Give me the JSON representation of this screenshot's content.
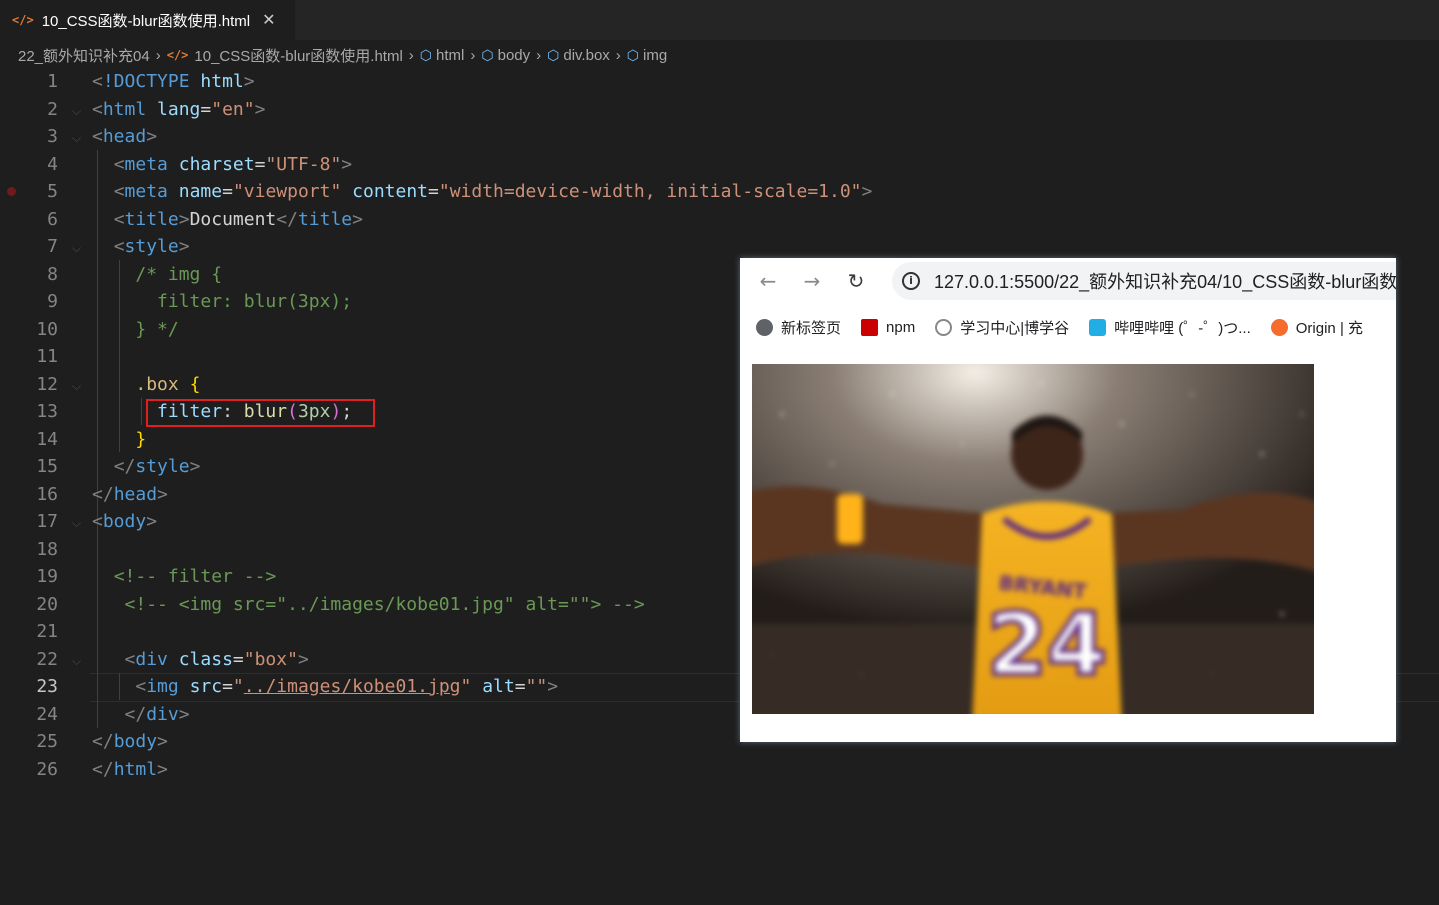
{
  "tab": {
    "icon": "</>",
    "title": "10_CSS函数-blur函数使用.html",
    "close": "✕"
  },
  "breadcrumb": [
    "22_额外知识补充04",
    "10_CSS函数-blur函数使用.html",
    "html",
    "body",
    "div.box",
    "img"
  ],
  "line_numbers": [
    "1",
    "2",
    "3",
    "4",
    "5",
    "6",
    "7",
    "8",
    "9",
    "10",
    "11",
    "12",
    "13",
    "14",
    "15",
    "16",
    "17",
    "18",
    "19",
    "20",
    "21",
    "22",
    "23",
    "24",
    "25",
    "26"
  ],
  "active_line": "23",
  "browser": {
    "url": "127.0.0.1:5500/22_额外知识补充04/10_CSS函数-blur函数",
    "bookmarks": [
      "新标签页",
      "npm",
      "学习中心|博学谷",
      "哔哩哔哩 (゜-゜)つ...",
      "Origin | 充"
    ],
    "image_caption": "24"
  },
  "code": {
    "l1_doctype": "!DOCTYPE",
    "l1_html": "html",
    "l2_tag": "html",
    "l2_attr": "lang",
    "l2_val": "\"en\"",
    "l3_tag": "head",
    "l4_tag": "meta",
    "l4_attr": "charset",
    "l4_val": "\"UTF-8\"",
    "l5_tag": "meta",
    "l5_attr1": "name",
    "l5_val1": "\"viewport\"",
    "l5_attr2": "content",
    "l5_val2": "\"width=device-width, initial-scale=1.0\"",
    "l6_tag": "title",
    "l6_text": "Document",
    "l7_tag": "style",
    "l8": "/* img {",
    "l9": "filter: blur(3px);",
    "l10": "} */",
    "l12_sel": ".box",
    "l12_brace": "{",
    "l13_prop": "filter",
    "l13_fn": "blur",
    "l13_num": "3px",
    "l14_brace": "}",
    "l15_tag": "style",
    "l16_tag": "head",
    "l17_tag": "body",
    "l19": "<!-- filter -->",
    "l20": "<!-- <img src=\"../images/kobe01.jpg\" alt=\"\"> -->",
    "l22_tag": "div",
    "l22_attr": "class",
    "l22_val": "\"box\"",
    "l23_tag": "img",
    "l23_attr1": "src",
    "l23_val1": "../images/kobe01.jpg",
    "l23_attr2": "alt",
    "l23_val2": "\"\"",
    "l24_tag": "div",
    "l25_tag": "body",
    "l26_tag": "html"
  }
}
